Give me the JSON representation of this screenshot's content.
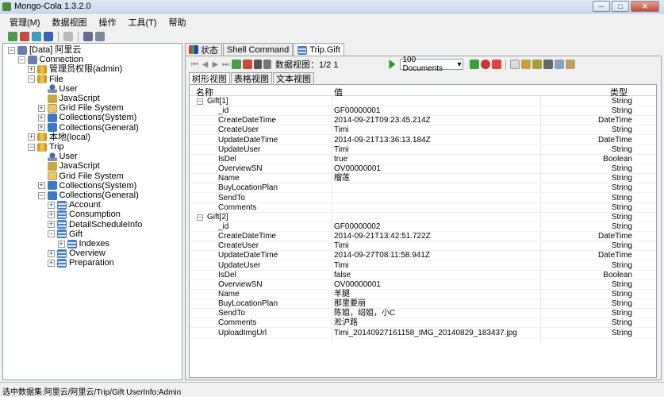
{
  "window": {
    "title": "Mongo-Cola  1.3.2.0"
  },
  "menu": [
    "管理(M)",
    "数据视图",
    "操作",
    "工具(T)",
    "帮助"
  ],
  "tree": [
    {
      "label": "[Data]  阿里云",
      "indent": 0,
      "expander": "-",
      "icon": "server"
    },
    {
      "label": "Connection",
      "indent": 1,
      "expander": "-",
      "icon": "server"
    },
    {
      "label": "管理员权限(admin)",
      "indent": 2,
      "expander": "+",
      "icon": "db"
    },
    {
      "label": "File",
      "indent": 2,
      "expander": "-",
      "icon": "db"
    },
    {
      "label": "User",
      "indent": 3,
      "expander": "",
      "icon": "user"
    },
    {
      "label": "JavaScript",
      "indent": 3,
      "expander": "",
      "icon": "js"
    },
    {
      "label": "Grid File System",
      "indent": 3,
      "expander": "+",
      "icon": "folder"
    },
    {
      "label": "Collections(System)",
      "indent": 3,
      "expander": "+",
      "icon": "coll"
    },
    {
      "label": "Collections(General)",
      "indent": 3,
      "expander": "+",
      "icon": "coll"
    },
    {
      "label": "本地(local)",
      "indent": 2,
      "expander": "+",
      "icon": "db"
    },
    {
      "label": "Trip",
      "indent": 2,
      "expander": "-",
      "icon": "db"
    },
    {
      "label": "User",
      "indent": 3,
      "expander": "",
      "icon": "user"
    },
    {
      "label": "JavaScript",
      "indent": 3,
      "expander": "",
      "icon": "js"
    },
    {
      "label": "Grid File System",
      "indent": 3,
      "expander": "",
      "icon": "folder"
    },
    {
      "label": "Collections(System)",
      "indent": 3,
      "expander": "+",
      "icon": "coll"
    },
    {
      "label": "Collections(General)",
      "indent": 3,
      "expander": "-",
      "icon": "coll"
    },
    {
      "label": "Account",
      "indent": 4,
      "expander": "+",
      "icon": "table"
    },
    {
      "label": "Consumption",
      "indent": 4,
      "expander": "+",
      "icon": "table"
    },
    {
      "label": "DetailScheduleInfo",
      "indent": 4,
      "expander": "+",
      "icon": "table"
    },
    {
      "label": "Gift",
      "indent": 4,
      "expander": "-",
      "icon": "table"
    },
    {
      "label": "Indexes",
      "indent": 5,
      "expander": "+",
      "icon": "table"
    },
    {
      "label": "Overview",
      "indent": 4,
      "expander": "+",
      "icon": "table"
    },
    {
      "label": "Preparation",
      "indent": 4,
      "expander": "+",
      "icon": "table"
    }
  ],
  "tabs": [
    {
      "label": "状态",
      "icon": "chart",
      "active": false
    },
    {
      "label": "Shell Command",
      "icon": "",
      "active": false
    },
    {
      "label": "Trip.Gift",
      "icon": "table",
      "active": true
    }
  ],
  "data_toolbar": {
    "view_label": "数据视图：1/2  1",
    "page_size": "100 Documents"
  },
  "subtabs": [
    "树形视图",
    "表格视图",
    "文本视图"
  ],
  "grid_headers": {
    "name": "名称",
    "value": "值",
    "type": "类型"
  },
  "rows": [
    {
      "name": "Gift[1]",
      "value": "",
      "type": "String",
      "parent": true
    },
    {
      "name": "_id",
      "value": "GF00000001",
      "type": "String"
    },
    {
      "name": "CreateDateTime",
      "value": "2014-09-21T09:23:45.214Z",
      "type": "DateTime"
    },
    {
      "name": "CreateUser",
      "value": "Timi",
      "type": "String"
    },
    {
      "name": "UpdateDateTime",
      "value": "2014-09-21T13:36:13.184Z",
      "type": "DateTime"
    },
    {
      "name": "UpdateUser",
      "value": "Timi",
      "type": "String"
    },
    {
      "name": "IsDel",
      "value": "true",
      "type": "Boolean"
    },
    {
      "name": "OverviewSN",
      "value": "OV00000001",
      "type": "String"
    },
    {
      "name": "Name",
      "value": "榴莲",
      "type": "String"
    },
    {
      "name": "BuyLocationPlan",
      "value": "",
      "type": "String"
    },
    {
      "name": "SendTo",
      "value": "",
      "type": "String"
    },
    {
      "name": "Comments",
      "value": "",
      "type": "String"
    },
    {
      "name": "Gift[2]",
      "value": "",
      "type": "String",
      "parent": true
    },
    {
      "name": "_id",
      "value": "GF00000002",
      "type": "String"
    },
    {
      "name": "CreateDateTime",
      "value": "2014-09-21T13:42:51.722Z",
      "type": "DateTime"
    },
    {
      "name": "CreateUser",
      "value": "Timi",
      "type": "String"
    },
    {
      "name": "UpdateDateTime",
      "value": "2014-09-27T08:11:58.941Z",
      "type": "DateTime"
    },
    {
      "name": "UpdateUser",
      "value": "Timi",
      "type": "String"
    },
    {
      "name": "IsDel",
      "value": "false",
      "type": "Boolean"
    },
    {
      "name": "OverviewSN",
      "value": "OV00000001",
      "type": "String"
    },
    {
      "name": "Name",
      "value": "羊腿",
      "type": "String"
    },
    {
      "name": "BuyLocationPlan",
      "value": "那里要丽",
      "type": "String"
    },
    {
      "name": "SendTo",
      "value": "陈姐，绍姐，小C",
      "type": "String"
    },
    {
      "name": "Comments",
      "value": "淞沪路",
      "type": "String"
    },
    {
      "name": "UploadImgUrl",
      "value": "Timi_20140927161158_IMG_20140829_183437.jpg",
      "type": "String"
    }
  ],
  "status": "选中数据集:阿里云/阿里云/Trip/Gift  UserInfo:Admin"
}
